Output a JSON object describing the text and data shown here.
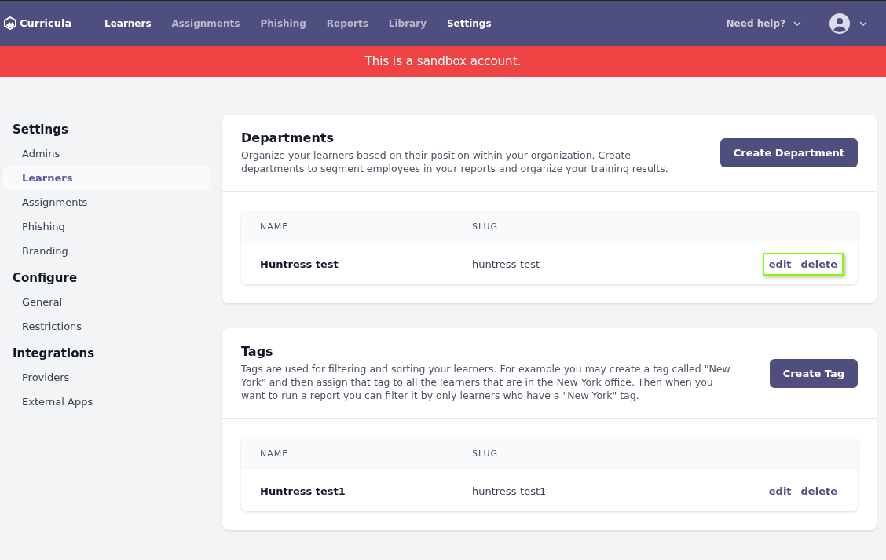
{
  "header": {
    "logo": "Curricula",
    "nav": [
      {
        "label": "Learners",
        "selected": true
      },
      {
        "label": "Assignments",
        "selected": false
      },
      {
        "label": "Phishing",
        "selected": false
      },
      {
        "label": "Reports",
        "selected": false
      },
      {
        "label": "Library",
        "selected": false
      },
      {
        "label": "Settings",
        "selected": true
      }
    ],
    "help": "Need help?"
  },
  "banner": "This is a sandbox account.",
  "sidebar": [
    {
      "heading": "Settings",
      "items": [
        {
          "label": "Admins",
          "selected": false
        },
        {
          "label": "Learners",
          "selected": true
        },
        {
          "label": "Assignments",
          "selected": false
        },
        {
          "label": "Phishing",
          "selected": false
        },
        {
          "label": "Branding",
          "selected": false
        }
      ]
    },
    {
      "heading": "Configure",
      "items": [
        {
          "label": "General",
          "selected": false
        },
        {
          "label": "Restrictions",
          "selected": false
        }
      ]
    },
    {
      "heading": "Integrations",
      "items": [
        {
          "label": "Providers",
          "selected": false
        },
        {
          "label": "External Apps",
          "selected": false
        }
      ]
    }
  ],
  "sections": [
    {
      "title": "Departments",
      "description": "Organize your learners based on their position within your organization. Create departments to segment employees in your reports and organize your training results.",
      "button": "Create Department",
      "columns": [
        "NAME",
        "SLUG"
      ],
      "rows": [
        {
          "name": "Huntress test",
          "slug": "huntress-test",
          "edit": "edit",
          "delete": "delete",
          "highlighted": true
        }
      ]
    },
    {
      "title": "Tags",
      "description": "Tags are used for filtering and sorting your learners. For example you may create a tag called \"New York\" and then assign that tag to all the learners that are in the New York office. Then when you want to run a report you can filter it by only learners who have a \"New York\" tag.",
      "button": "Create Tag",
      "columns": [
        "NAME",
        "SLUG"
      ],
      "rows": [
        {
          "name": "Huntress test1",
          "slug": "huntress-test1",
          "edit": "edit",
          "delete": "delete",
          "highlighted": false
        }
      ]
    }
  ]
}
